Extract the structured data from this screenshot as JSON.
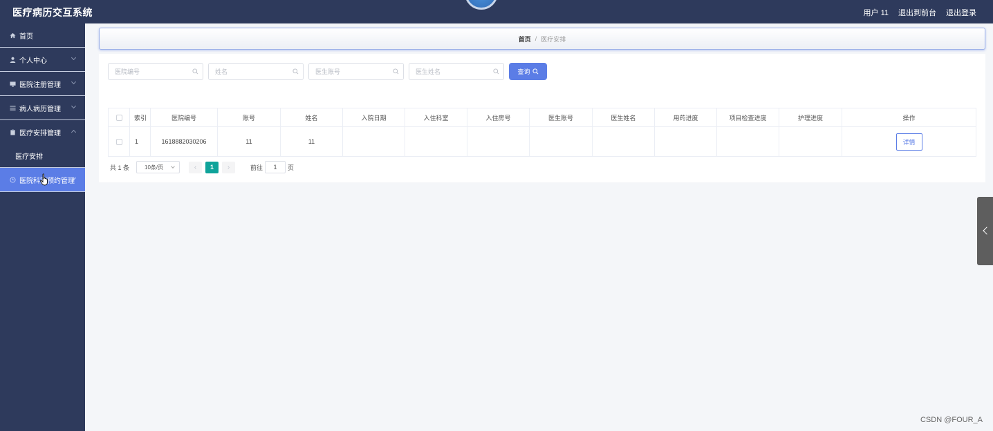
{
  "app": {
    "title": "医疗病历交互系统"
  },
  "header": {
    "user_label": "用户 11",
    "back_front_label": "退出到前台",
    "logout_label": "退出登录"
  },
  "sidebar": {
    "items": [
      {
        "label": "首页",
        "icon": "home-icon"
      },
      {
        "label": "个人中心",
        "icon": "user-icon"
      },
      {
        "label": "医院注册管理",
        "icon": "monitor-icon"
      },
      {
        "label": "病人病历管理",
        "icon": "list-icon"
      },
      {
        "label": "医疗安排管理",
        "icon": "clipboard-icon"
      },
      {
        "label": "医院科室预约管理",
        "icon": "clock-icon"
      }
    ],
    "sub_items": [
      {
        "label": "医疗安排"
      }
    ]
  },
  "breadcrumb": {
    "home": "首页",
    "separator": "/",
    "current": "医疗安排"
  },
  "search": {
    "fields": [
      {
        "placeholder": "医院编号"
      },
      {
        "placeholder": "姓名"
      },
      {
        "placeholder": "医生账号"
      },
      {
        "placeholder": "医生姓名"
      }
    ],
    "button_label": "查询"
  },
  "table": {
    "columns": [
      "索引",
      "医院编号",
      "账号",
      "姓名",
      "入院日期",
      "入住科室",
      "入住房号",
      "医生账号",
      "医生姓名",
      "用药进度",
      "项目检查进度",
      "护理进度",
      "操作"
    ],
    "rows": [
      {
        "index": "1",
        "hospital_no": "1618882030206",
        "account": "11",
        "name": "11",
        "admit_date": "",
        "dept": "",
        "room": "",
        "doctor_account": "",
        "doctor_name": "",
        "medication": "",
        "exam": "",
        "nursing": "",
        "action": "详情"
      }
    ]
  },
  "pagination": {
    "total": "共 1 条",
    "page_size": "10条/页",
    "current_page": "1",
    "goto_label": "前往",
    "goto_value": "1",
    "page_suffix": "页"
  },
  "watermark": "CSDN @FOUR_A",
  "colors": {
    "header_bg": "#2e3a5c",
    "accent": "#5b7de6",
    "page_active": "#0fa39a"
  }
}
